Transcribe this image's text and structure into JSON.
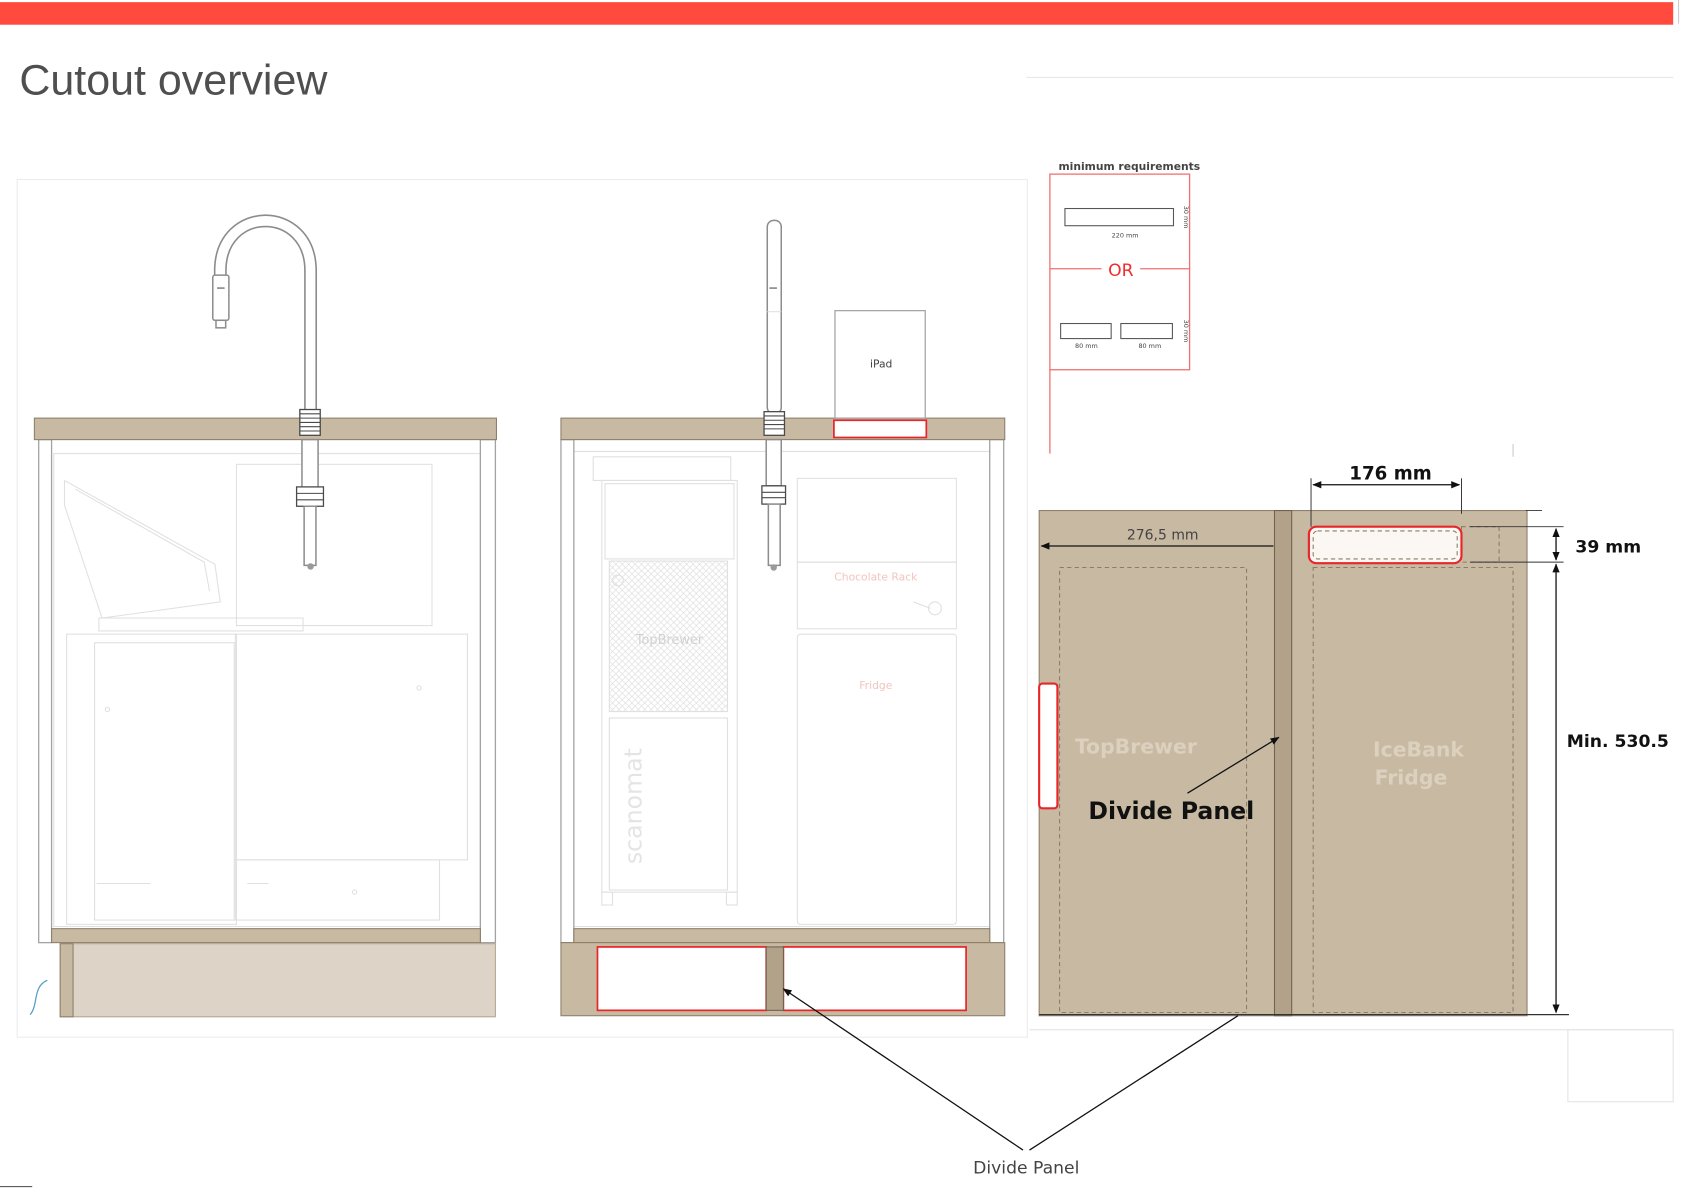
{
  "colors": {
    "accent": "#ff4a3d",
    "cutout_outline": "#e8262a",
    "panel_tan": "#c8b9a2",
    "divide_panel": "#b3a28a"
  },
  "slide": {
    "title": "Cutout overview"
  },
  "front_view_ipad": {
    "ipad_label": "iPad",
    "machine_labels": {
      "topbrewer": "TopBrewer",
      "scanomat": "scanomat",
      "chocolate_rack": "Chocolate Rack",
      "fridge": "Fridge"
    }
  },
  "minimum_requirements": {
    "heading": "minimum requirements",
    "single_slot": {
      "width": "220 mm",
      "height": "30 mm"
    },
    "separator": "OR",
    "double_slot": {
      "left_width": "80 mm",
      "right_width": "80 mm",
      "height": "30 mm"
    }
  },
  "plinth_detail": {
    "cutout_width": "176 mm",
    "cutout_offset": "276,5 mm",
    "cutout_height": "39 mm",
    "min_height": "Min. 530.5",
    "left_compartment": "TopBrewer",
    "right_compartment_line1": "IceBank",
    "right_compartment_line2": "Fridge",
    "divide_panel_label": "Divide Panel"
  },
  "callout": {
    "divide_panel_label": "Divide Panel"
  }
}
